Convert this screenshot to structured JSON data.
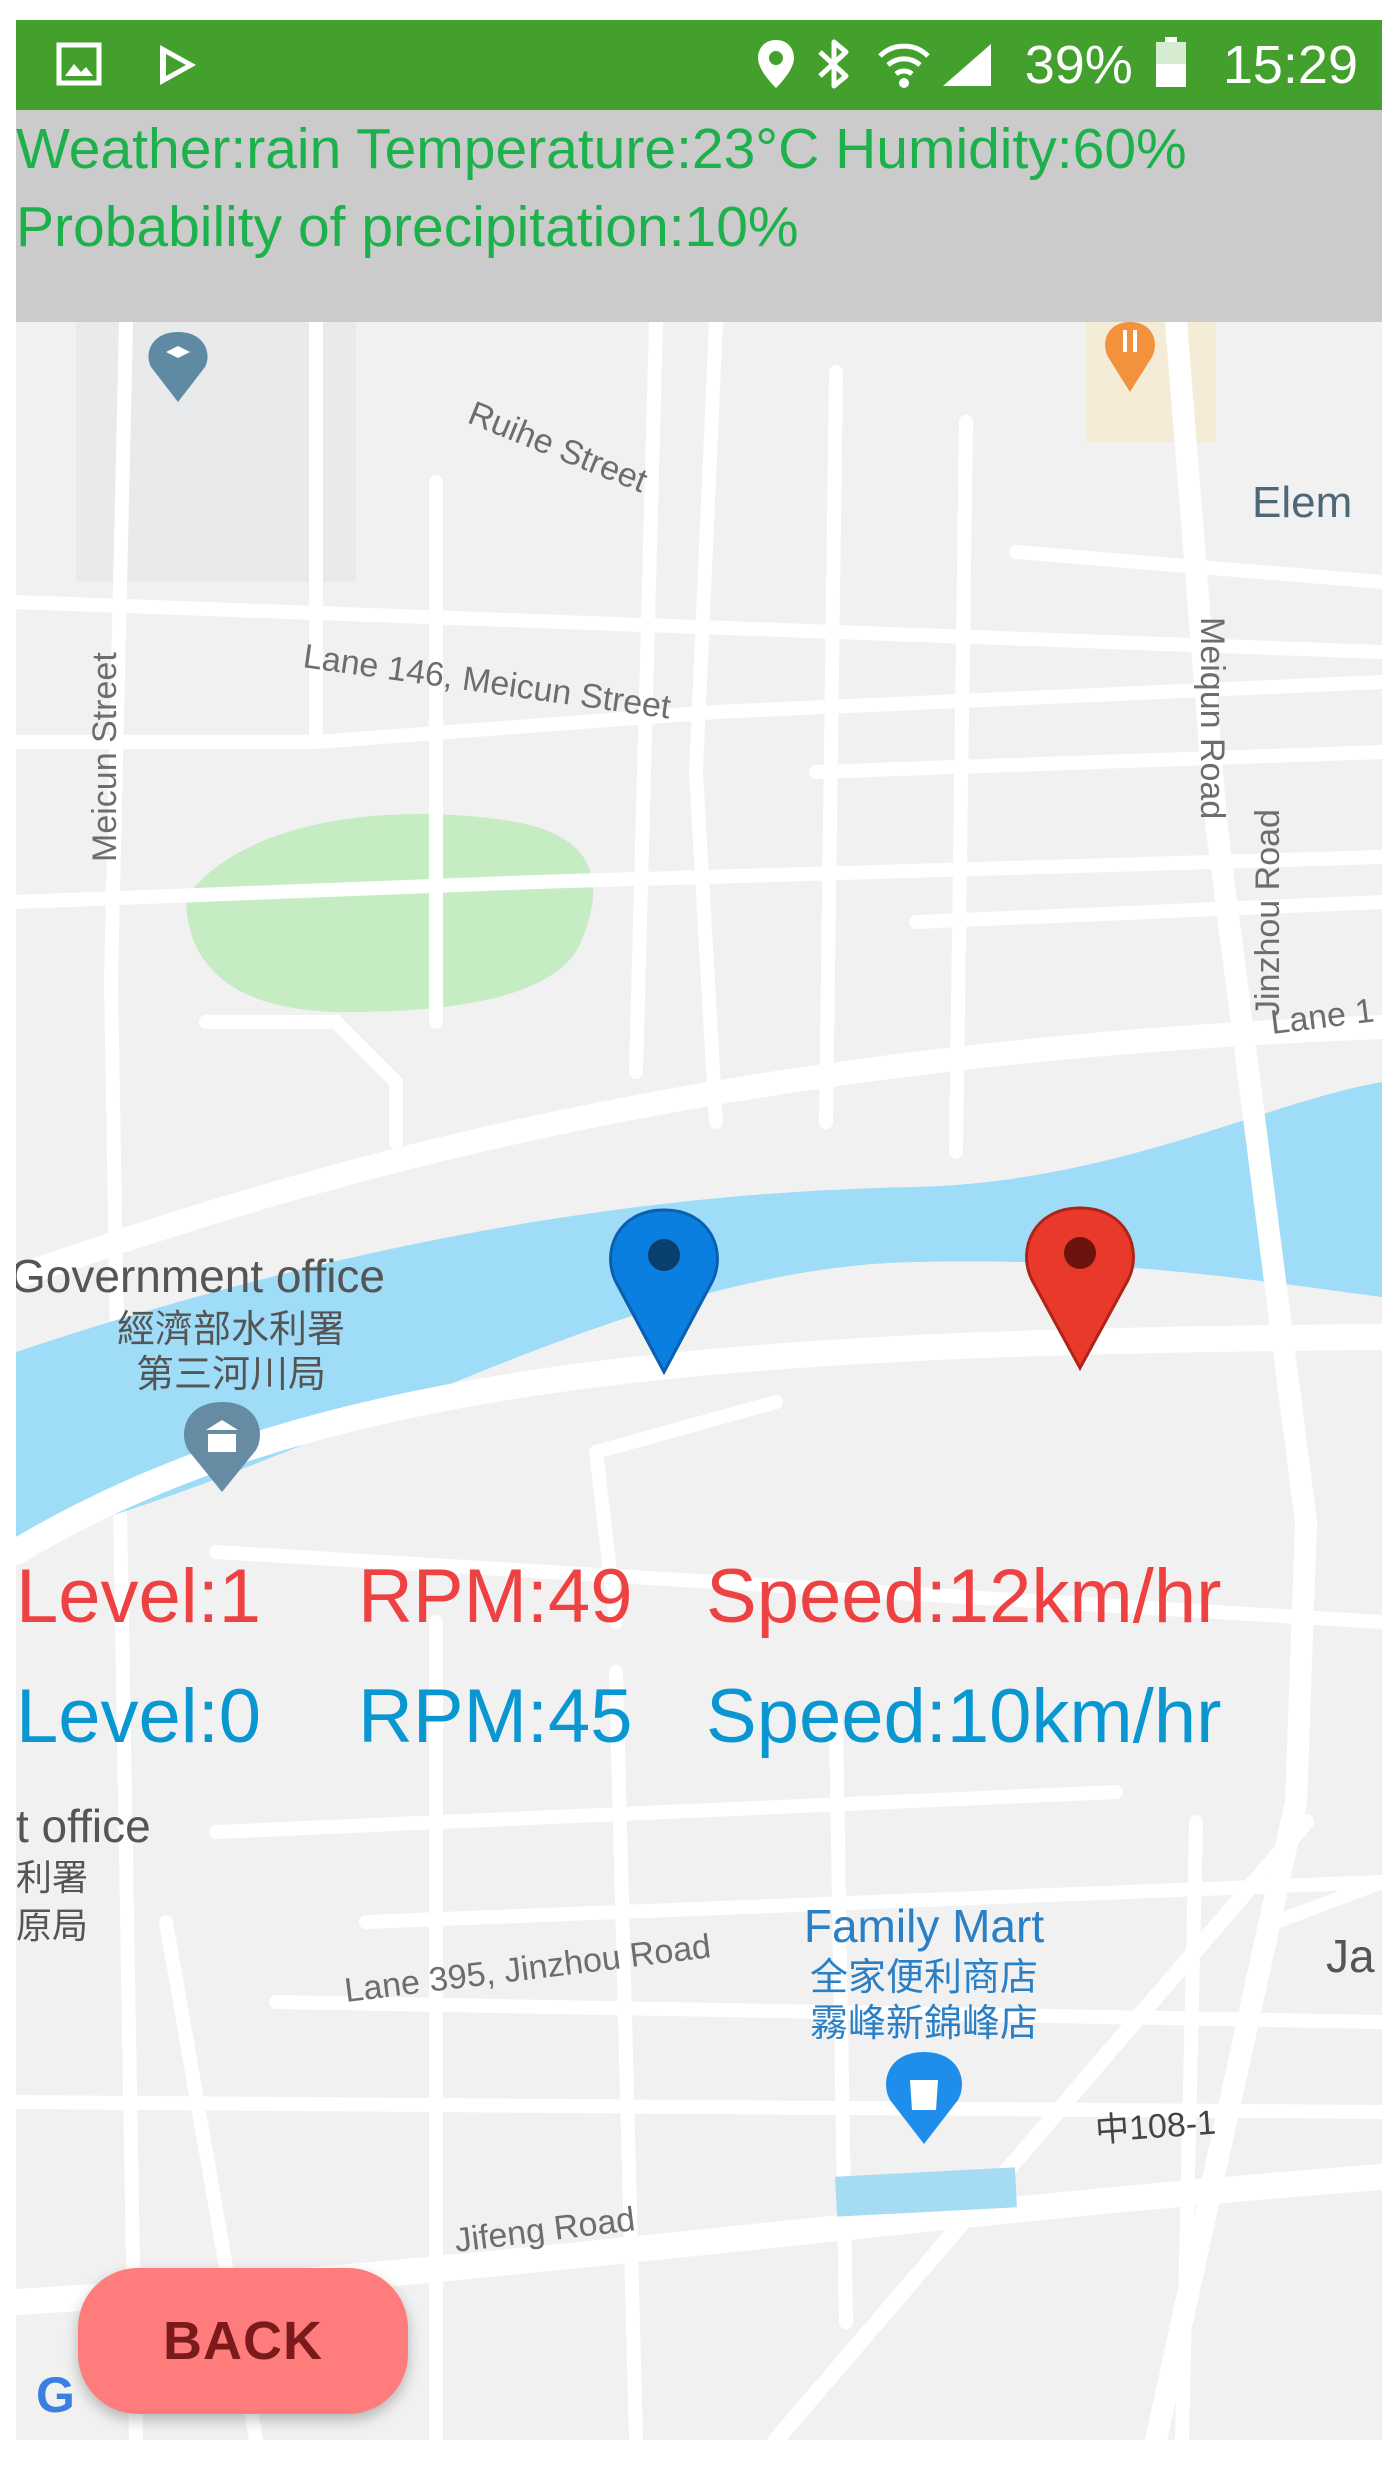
{
  "status_bar": {
    "battery": "39%",
    "time": "15:29",
    "icons": [
      "image-icon",
      "play-store-icon",
      "location-icon",
      "bluetooth-icon",
      "wifi-icon",
      "signal-icon",
      "battery-icon"
    ]
  },
  "weather": {
    "line1": "Weather:rain Temperature:23°C Humidity:60%",
    "line2": "Probability of precipitation:10%"
  },
  "map": {
    "labels": {
      "ruihe": "Ruihe Street",
      "lane146": "Lane 146, Meicun Street",
      "meicun": "Meicun Street",
      "meiqun": "Meiqun Road",
      "elem": "Elem",
      "lane1": "Lane 1",
      "gov_office": "Government office",
      "gov_cn1": "經濟部水利署",
      "gov_cn2": "第三河川局",
      "jinzhou": "Jinzhou Road",
      "t_office": "t office",
      "t_cn1": "利署",
      "t_cn2": "原局",
      "family_mart": "Family Mart",
      "fm_cn1": "全家便利商店",
      "fm_cn2": "霧峰新錦峰店",
      "lane395": "Lane 395, Jinzhou Road",
      "ja": "Ja",
      "zhong108": "中108-1",
      "jifeng": "Jifeng Road",
      "google_g": "G"
    },
    "marker_colors": {
      "blue": "#0a7fe0",
      "red": "#e8392b"
    }
  },
  "stats": {
    "red": {
      "level": "Level:1",
      "rpm": "RPM:49",
      "speed": "Speed:12km/hr",
      "color": "#ee4242"
    },
    "blue": {
      "level": "Level:0",
      "rpm": "RPM:45",
      "speed": "Speed:10km/hr",
      "color": "#0a97d1"
    }
  },
  "back_button": {
    "label": "BACK",
    "color": "#ff7c7c"
  }
}
